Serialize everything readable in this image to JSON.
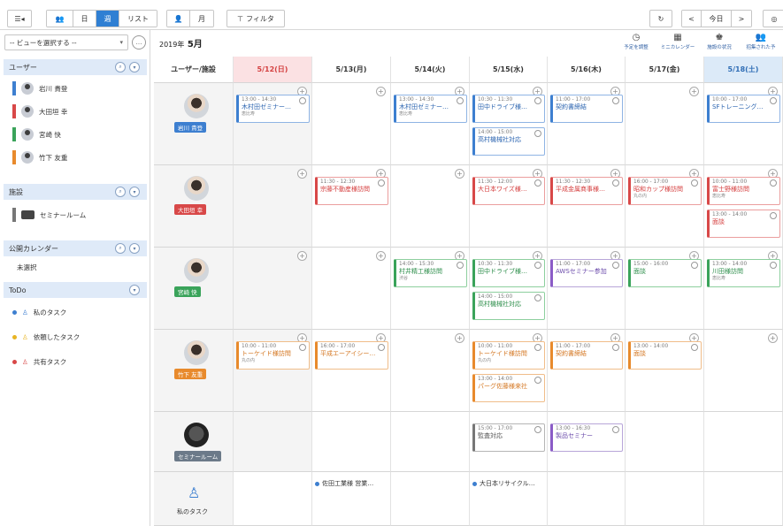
{
  "toolbar": {
    "menu_glyph": "☰◂",
    "users_glyph": "👥",
    "day": "日",
    "week": "週",
    "list": "リスト",
    "person_glyph": "👤",
    "month": "月",
    "filter_glyph": "⊤",
    "filter": "フィルタ",
    "refresh": "↻",
    "prev": "<",
    "today": "今日",
    "next": ">",
    "settings": "◎"
  },
  "sidebar": {
    "view_select": "-- ビューを選択する --",
    "view_caret": "▾",
    "view_more": "…",
    "users_title": "ユーザー",
    "users": [
      {
        "name": "岩川 貴登"
      },
      {
        "name": "大田垣 幸"
      },
      {
        "name": "宮崎 快"
      },
      {
        "name": "竹下 友重"
      }
    ],
    "facilities_title": "施設",
    "facility": "セミナールーム",
    "public_calendar_title": "公開カレンダー",
    "public_calendar_value": "未選択",
    "todo_title": "ToDo",
    "todos": [
      {
        "label": "私のタスク",
        "glyph": "♙"
      },
      {
        "label": "依頼したタスク",
        "glyph": "♙"
      },
      {
        "label": "共有タスク",
        "glyph": "♙"
      }
    ]
  },
  "main": {
    "year": "2019年",
    "month": "5月",
    "header_actions": [
      {
        "label": "予定を調整",
        "glyph": "◷"
      },
      {
        "label": "ミニカレンダー",
        "glyph": "▦"
      },
      {
        "label": "施設の状況",
        "glyph": "♚"
      },
      {
        "label": "招集された予",
        "glyph": "👥"
      }
    ],
    "columns": [
      "ユーザー/施設",
      "5/12(日)",
      "5/13(月)",
      "5/14(火)",
      "5/15(水)",
      "5/16(木)",
      "5/17(金)",
      "5/18(土)"
    ],
    "row_labels": [
      "岩川 貴登",
      "大田垣 幸",
      "宮崎 快",
      "竹下 友重",
      "セミナールーム",
      "私のタスク"
    ],
    "task_icon": "♙",
    "plus": "+",
    "events": [
      {
        "row": 0,
        "col": 1,
        "slot": 0,
        "color": "blue",
        "time": "13:00 - 14:30",
        "title": "木村田ゼミナー…",
        "loc": "恵比寿"
      },
      {
        "row": 0,
        "col": 3,
        "slot": 0,
        "color": "blue",
        "time": "13:00 - 14:30",
        "title": "木村田ゼミナー…",
        "loc": "恵比寿"
      },
      {
        "row": 0,
        "col": 4,
        "slot": 0,
        "color": "blue",
        "time": "10:30 - 11:30",
        "title": "田中ドライブ様…",
        "loc": ""
      },
      {
        "row": 0,
        "col": 4,
        "slot": 1,
        "color": "blue",
        "time": "14:00 - 15:00",
        "title": "高村機械社対応",
        "loc": ""
      },
      {
        "row": 0,
        "col": 5,
        "slot": 0,
        "color": "blue",
        "time": "11:00 - 17:00",
        "title": "契約書締結",
        "loc": ""
      },
      {
        "row": 0,
        "col": 7,
        "slot": 0,
        "color": "blue",
        "time": "10:00 - 17:00",
        "title": "SFトレーニング…",
        "loc": ""
      },
      {
        "row": 1,
        "col": 2,
        "slot": 0,
        "color": "red",
        "time": "11:30 - 12:30",
        "title": "宗藤不動産様訪問",
        "loc": ""
      },
      {
        "row": 1,
        "col": 4,
        "slot": 0,
        "color": "red",
        "time": "11:30 - 12:00",
        "title": "大日本ワイズ様…",
        "loc": ""
      },
      {
        "row": 1,
        "col": 5,
        "slot": 0,
        "color": "red",
        "time": "11:30 - 12:30",
        "title": "平成金属商事様…",
        "loc": ""
      },
      {
        "row": 1,
        "col": 6,
        "slot": 0,
        "color": "red",
        "time": "16:00 - 17:00",
        "title": "昭和カップ様訪問",
        "loc": "丸の内"
      },
      {
        "row": 1,
        "col": 7,
        "slot": 0,
        "color": "red",
        "time": "10:00 - 11:00",
        "title": "富士野様訪問",
        "loc": "恵比寿"
      },
      {
        "row": 1,
        "col": 7,
        "slot": 1,
        "color": "red",
        "time": "13:00 - 14:00",
        "title": "面談",
        "loc": ""
      },
      {
        "row": 2,
        "col": 3,
        "slot": 0,
        "color": "green",
        "time": "14:00 - 15:30",
        "title": "村井精工様訪問",
        "loc": "渋谷"
      },
      {
        "row": 2,
        "col": 4,
        "slot": 0,
        "color": "green",
        "time": "10:30 - 11:30",
        "title": "田中ドライブ様…",
        "loc": ""
      },
      {
        "row": 2,
        "col": 4,
        "slot": 1,
        "color": "green",
        "time": "14:00 - 15:00",
        "title": "高村機械社対応",
        "loc": ""
      },
      {
        "row": 2,
        "col": 5,
        "slot": 0,
        "color": "purple",
        "time": "11:00 - 17:00",
        "title": "AWSセミナー参加",
        "loc": ""
      },
      {
        "row": 2,
        "col": 6,
        "slot": 0,
        "color": "green",
        "time": "15:00 - 16:00",
        "title": "面談",
        "loc": ""
      },
      {
        "row": 2,
        "col": 7,
        "slot": 0,
        "color": "green",
        "time": "13:00 - 14:00",
        "title": "川田様訪問",
        "loc": "恵比寿"
      },
      {
        "row": 3,
        "col": 1,
        "slot": 0,
        "color": "orange",
        "time": "10:00 - 11:00",
        "title": "トーケイド様訪問",
        "loc": "丸の内"
      },
      {
        "row": 3,
        "col": 2,
        "slot": 0,
        "color": "orange",
        "time": "16:00 - 17:00",
        "title": "平成エーアイシー…",
        "loc": ""
      },
      {
        "row": 3,
        "col": 4,
        "slot": 0,
        "color": "orange",
        "time": "10:00 - 11:00",
        "title": "トーケイド様訪問",
        "loc": "丸の内"
      },
      {
        "row": 3,
        "col": 4,
        "slot": 1,
        "color": "orange",
        "time": "13:00 - 14:00",
        "title": "パーグ佐藤様来社",
        "loc": ""
      },
      {
        "row": 3,
        "col": 5,
        "slot": 0,
        "color": "orange",
        "time": "11:00 - 17:00",
        "title": "契約書締結",
        "loc": ""
      },
      {
        "row": 3,
        "col": 6,
        "slot": 0,
        "color": "orange",
        "time": "13:00 - 14:00",
        "title": "面談",
        "loc": ""
      },
      {
        "row": 4,
        "col": 4,
        "slot": 0,
        "color": "gray",
        "time": "15:00 - 17:00",
        "title": "監査対応",
        "loc": ""
      },
      {
        "row": 4,
        "col": 5,
        "slot": 0,
        "color": "purple",
        "time": "13:00 - 16:30",
        "title": "製品セミナー",
        "loc": ""
      }
    ],
    "tasks": [
      {
        "col": 2,
        "label": "佐田工業様 営業…"
      },
      {
        "col": 4,
        "label": "大日本リサイクル…"
      }
    ]
  }
}
